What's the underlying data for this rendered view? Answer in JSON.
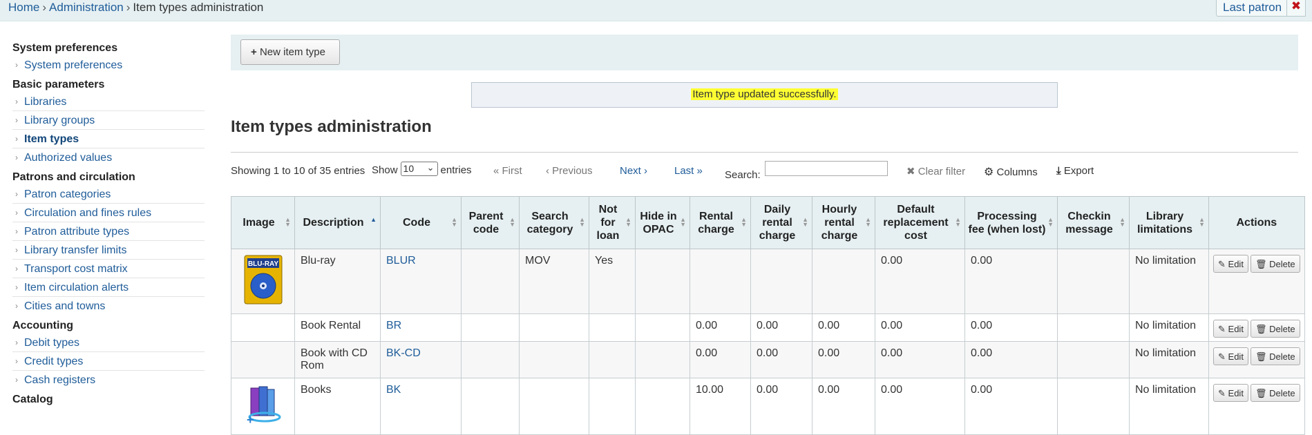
{
  "breadcrumb": [
    {
      "label": "Home",
      "link": true
    },
    {
      "label": "Administration",
      "link": true
    },
    {
      "label": "Item types administration",
      "link": false
    }
  ],
  "breadcrumb_sep": "›",
  "header": {
    "last_patron": "Last patron",
    "close": "✖"
  },
  "sidebar": [
    {
      "heading": "System preferences",
      "items": [
        {
          "label": "System preferences"
        }
      ]
    },
    {
      "heading": "Basic parameters",
      "items": [
        {
          "label": "Libraries"
        },
        {
          "label": "Library groups"
        },
        {
          "label": "Item types",
          "active": true
        },
        {
          "label": "Authorized values"
        }
      ]
    },
    {
      "heading": "Patrons and circulation",
      "items": [
        {
          "label": "Patron categories"
        },
        {
          "label": "Circulation and fines rules"
        },
        {
          "label": "Patron attribute types"
        },
        {
          "label": "Library transfer limits"
        },
        {
          "label": "Transport cost matrix"
        },
        {
          "label": "Item circulation alerts"
        },
        {
          "label": "Cities and towns"
        }
      ]
    },
    {
      "heading": "Accounting",
      "items": [
        {
          "label": "Debit types"
        },
        {
          "label": "Credit types"
        },
        {
          "label": "Cash registers"
        }
      ]
    },
    {
      "heading": "Catalog",
      "items": []
    }
  ],
  "toolbar": {
    "new_button": "New item type"
  },
  "alert": "Item type updated successfully.",
  "page_title": "Item types administration",
  "controls": {
    "info": "Showing 1 to 10 of 35 entries",
    "show": "Show",
    "page_size": "10",
    "entries": "entries",
    "first": "« First",
    "previous": "‹ Previous",
    "next": "Next ›",
    "last": "Last »",
    "search_label": "Search:",
    "search_value": "",
    "clear_filter": "Clear filter",
    "columns": "Columns",
    "export": "Export"
  },
  "table": {
    "headers": [
      "Image",
      "Description",
      "Code",
      "Parent code",
      "Search category",
      "Not for loan",
      "Hide in OPAC",
      "Rental charge",
      "Daily rental charge",
      "Hourly rental charge",
      "Default replacement cost",
      "Processing fee (when lost)",
      "Checkin message",
      "Library limitations",
      "Actions"
    ],
    "edit_label": "Edit",
    "delete_label": "Delete",
    "rows": [
      {
        "image": "bluray",
        "description": "Blu-ray",
        "code": "BLUR",
        "parent": "",
        "search_category": "MOV",
        "not_for_loan": "Yes",
        "hide": "",
        "rental": "",
        "daily": "",
        "hourly": "",
        "replacement": "0.00",
        "processing": "0.00",
        "checkin": "",
        "limitations": "No limitation"
      },
      {
        "image": "",
        "description": "Book Rental",
        "code": "BR",
        "parent": "",
        "search_category": "",
        "not_for_loan": "",
        "hide": "",
        "rental": "0.00",
        "daily": "0.00",
        "hourly": "0.00",
        "replacement": "0.00",
        "processing": "0.00",
        "checkin": "",
        "limitations": "No limitation"
      },
      {
        "image": "",
        "description": "Book with CD Rom",
        "code": "BK-CD",
        "parent": "",
        "search_category": "",
        "not_for_loan": "",
        "hide": "",
        "rental": "0.00",
        "daily": "0.00",
        "hourly": "0.00",
        "replacement": "0.00",
        "processing": "0.00",
        "checkin": "",
        "limitations": "No limitation"
      },
      {
        "image": "books",
        "description": "Books",
        "code": "BK",
        "parent": "",
        "search_category": "",
        "not_for_loan": "",
        "hide": "",
        "rental": "10.00",
        "daily": "0.00",
        "hourly": "0.00",
        "replacement": "0.00",
        "processing": "0.00",
        "checkin": "",
        "limitations": "No limitation"
      }
    ]
  },
  "bluray_label": "BLU-RAY"
}
